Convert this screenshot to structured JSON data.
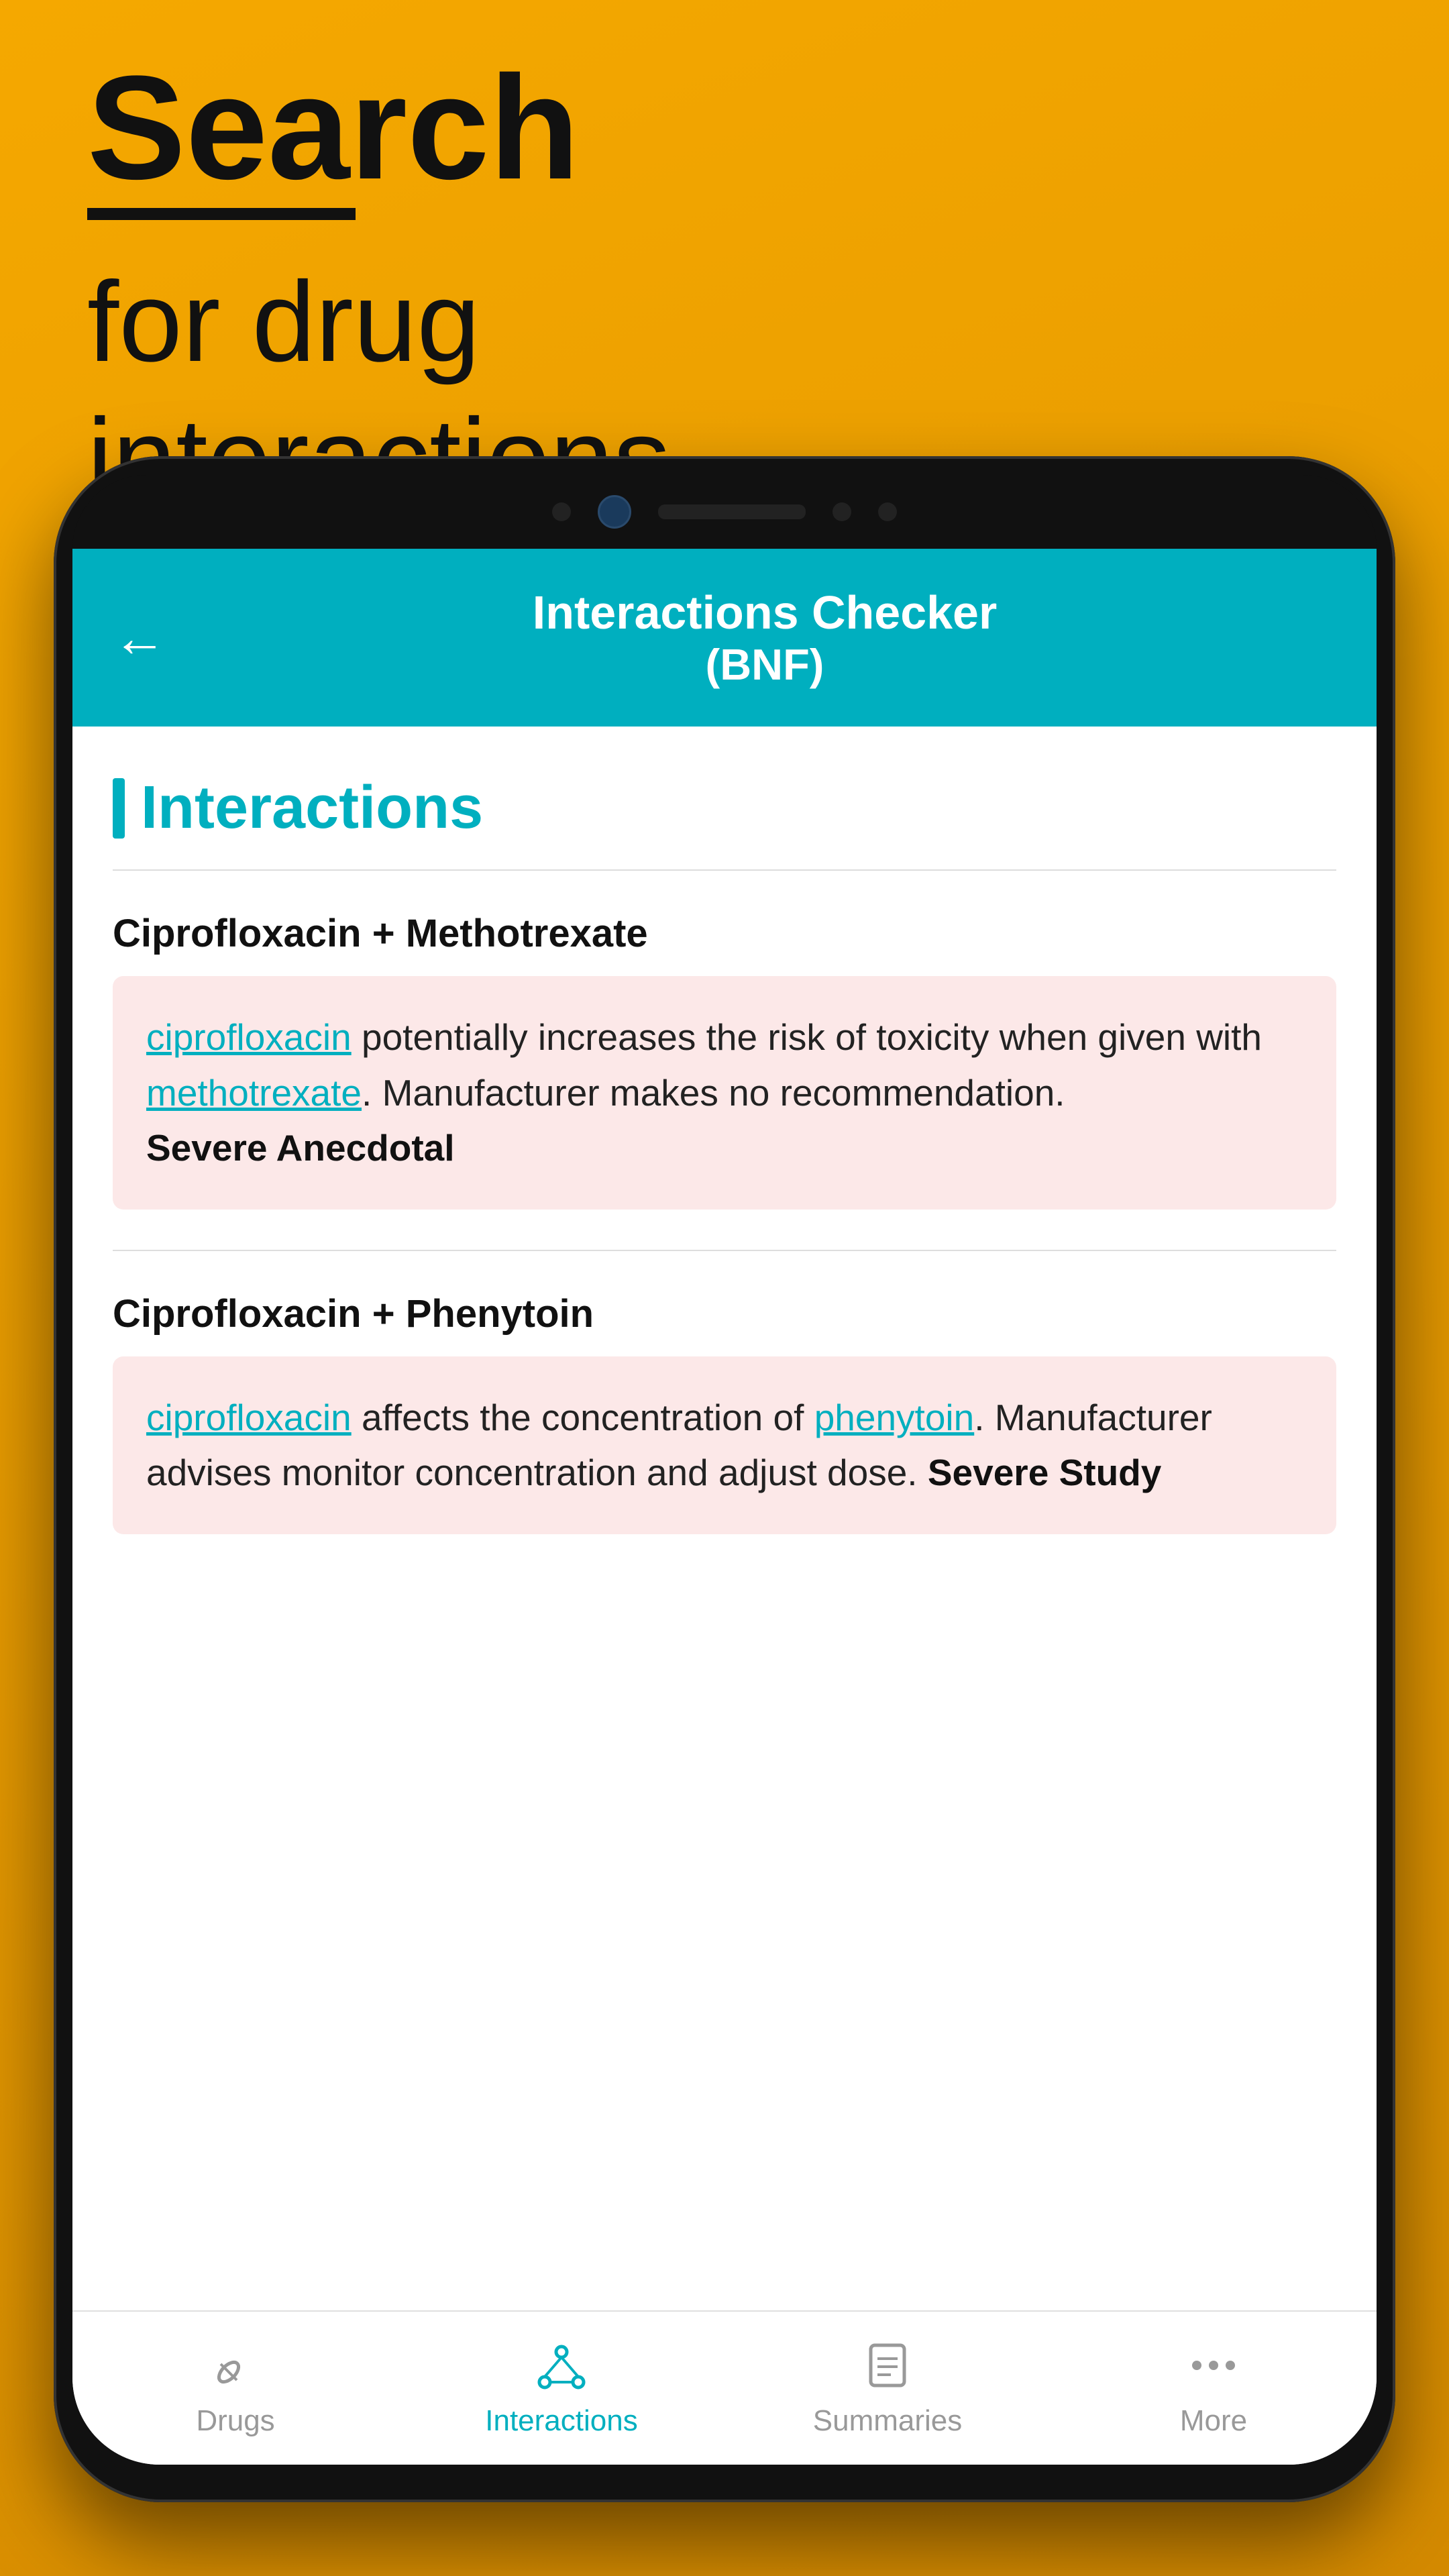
{
  "hero": {
    "search_label": "Search",
    "subtitle_line1": "for drug",
    "subtitle_line2": "interactions"
  },
  "app_header": {
    "back_label": "←",
    "title_main": "Interactions Checker",
    "title_sub": "(BNF)"
  },
  "section": {
    "heading": "Interactions"
  },
  "interactions": [
    {
      "pair": "Ciprofloxacin + Methotrexate",
      "drug1": "ciprofloxacin",
      "middle_text": " potentially increases the risk of toxicity when given with ",
      "drug2": "methotrexate",
      "end_text": ". Manufacturer makes no recommendation.",
      "severity": "Severe Anecdotal"
    },
    {
      "pair": "Ciprofloxacin + Phenytoin",
      "drug1": "ciprofloxacin",
      "middle_text": " affects the concentration of ",
      "drug2": "phenytoin",
      "end_text": ". Manufacturer advises monitor concentration and adjust dose.",
      "severity": "Severe Study"
    }
  ],
  "bottom_nav": [
    {
      "label": "Drugs",
      "active": false,
      "icon": "pill"
    },
    {
      "label": "Interactions",
      "active": true,
      "icon": "interactions"
    },
    {
      "label": "Summaries",
      "active": false,
      "icon": "summaries"
    },
    {
      "label": "More",
      "active": false,
      "icon": "more"
    }
  ]
}
